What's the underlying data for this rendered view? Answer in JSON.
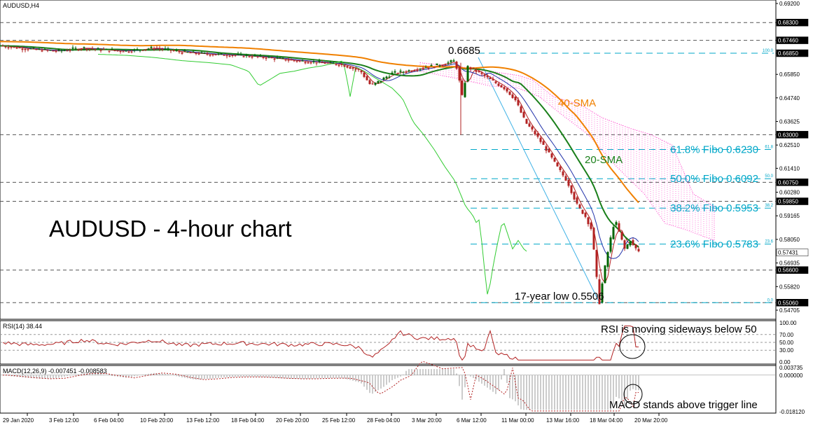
{
  "chart_data": {
    "type": "candlestick",
    "symbol": "AUDUSD,H4",
    "main_title": "AUDUSD - 4-hour chart",
    "price_scale": {
      "min": 0.5444,
      "max": 0.692,
      "ticks": [
        "0.69200",
        "0.68300",
        "0.67460",
        "0.66850",
        "0.65850",
        "0.64740",
        "0.63625",
        "0.62510",
        "0.61410",
        "0.60280",
        "0.59165",
        "0.58050",
        "0.56935",
        "0.55820",
        "0.54705"
      ],
      "tags": [
        {
          "label": "0.68300",
          "value": 0.683,
          "dark": true
        },
        {
          "label": "0.67460",
          "value": 0.6746,
          "dark": true
        },
        {
          "label": "0.66850",
          "value": 0.6685,
          "dark": true
        },
        {
          "label": "0.63000",
          "value": 0.63,
          "dark": true
        },
        {
          "label": "0.60750",
          "value": 0.6075,
          "dark": true
        },
        {
          "label": "0.59850",
          "value": 0.5985,
          "dark": true
        },
        {
          "label": "0.57431",
          "value": 0.57431,
          "dark": false
        },
        {
          "label": "0.56600",
          "value": 0.566,
          "dark": true
        },
        {
          "label": "0.55060",
          "value": 0.5506,
          "dark": true
        }
      ]
    },
    "horizontal_levels": [
      0.683,
      0.6746,
      0.63,
      0.6075,
      0.5985,
      0.566,
      0.5506
    ],
    "fibonacci": {
      "high": 0.6685,
      "low": 0.5506,
      "levels": [
        {
          "tag": "100.0",
          "value": 0.6685,
          "label": ""
        },
        {
          "tag": "61.8",
          "value": 0.623,
          "label": "61.8% Fibo 0.6230"
        },
        {
          "tag": "50.0",
          "value": 0.6092,
          "label": "50.0% Fibo 0.6092"
        },
        {
          "tag": "38.2",
          "value": 0.5953,
          "label": "38.2% Fibo 0.5953"
        },
        {
          "tag": "23.6",
          "value": 0.5783,
          "label": "23.6% Fibo 0.5783"
        },
        {
          "tag": "0.0",
          "value": 0.5506,
          "label": ""
        }
      ]
    },
    "annotations": {
      "high": "0.6685",
      "low": "17-year low 0.5506",
      "sma40": "40-SMA",
      "sma20": "20-SMA",
      "rsi_note": "RSI is moving sideways below 50",
      "macd_note": "MACD stands above trigger line"
    },
    "x_labels": [
      "29 Jan 2020",
      "3 Feb 12:00",
      "6 Feb 04:00",
      "10 Feb 20:00",
      "13 Feb 12:00",
      "18 Feb 04:00",
      "20 Feb 20:00",
      "25 Feb 12:00",
      "28 Feb 04:00",
      "3 Mar 20:00",
      "6 Mar 12:00",
      "11 Mar 00:00",
      "13 Mar 16:00",
      "18 Mar 04:00",
      "20 Mar 20:00"
    ],
    "price_path": [
      [
        0,
        0.672
      ],
      [
        40,
        0.6705
      ],
      [
        80,
        0.6695
      ],
      [
        120,
        0.671
      ],
      [
        150,
        0.67
      ],
      [
        180,
        0.6695
      ],
      [
        220,
        0.671
      ],
      [
        260,
        0.669
      ],
      [
        300,
        0.668
      ],
      [
        340,
        0.6675
      ],
      [
        380,
        0.6665
      ],
      [
        420,
        0.665
      ],
      [
        460,
        0.664
      ],
      [
        490,
        0.663
      ],
      [
        515,
        0.66
      ],
      [
        530,
        0.653
      ],
      [
        545,
        0.656
      ],
      [
        560,
        0.659
      ],
      [
        580,
        0.66
      ],
      [
        600,
        0.6615
      ],
      [
        620,
        0.6625
      ],
      [
        640,
        0.664
      ],
      [
        650,
        0.665
      ],
      [
        655,
        0.657
      ],
      [
        660,
        0.648
      ],
      [
        668,
        0.662
      ],
      [
        680,
        0.66
      ],
      [
        700,
        0.656
      ],
      [
        720,
        0.652
      ],
      [
        735,
        0.647
      ],
      [
        750,
        0.636
      ],
      [
        765,
        0.63
      ],
      [
        780,
        0.623
      ],
      [
        795,
        0.615
      ],
      [
        810,
        0.608
      ],
      [
        825,
        0.596
      ],
      [
        835,
        0.592
      ],
      [
        845,
        0.585
      ],
      [
        852,
        0.562
      ],
      [
        856,
        0.5506
      ],
      [
        862,
        0.564
      ],
      [
        870,
        0.578
      ],
      [
        878,
        0.59
      ],
      [
        885,
        0.583
      ],
      [
        892,
        0.576
      ],
      [
        900,
        0.58
      ],
      [
        908,
        0.576
      ],
      [
        914,
        0.5743
      ]
    ],
    "rsi": {
      "label": "RSI(14) 38.44",
      "period": 14,
      "value": 38.44,
      "ticks": [
        "100.00",
        "70.00",
        "50.00",
        "30.00",
        "0.00"
      ]
    },
    "macd": {
      "label": "MACD(12,26,9) -0.007451 -0.008583",
      "value": -0.007451,
      "signal": -0.008583,
      "ticks": [
        "0.003735",
        "0.000000",
        "-0.018120"
      ]
    },
    "colors": {
      "bull": "#006400",
      "bear": "#b22222",
      "sma20": "#1a7f1a",
      "sma40": "#f08000",
      "kijun": "#b22222",
      "tenkan": "#2233aa",
      "chikou": "#33cc33",
      "cloud": "#ff44cc",
      "fib": "#00a7c8",
      "trend": "#3fb2e6"
    }
  }
}
